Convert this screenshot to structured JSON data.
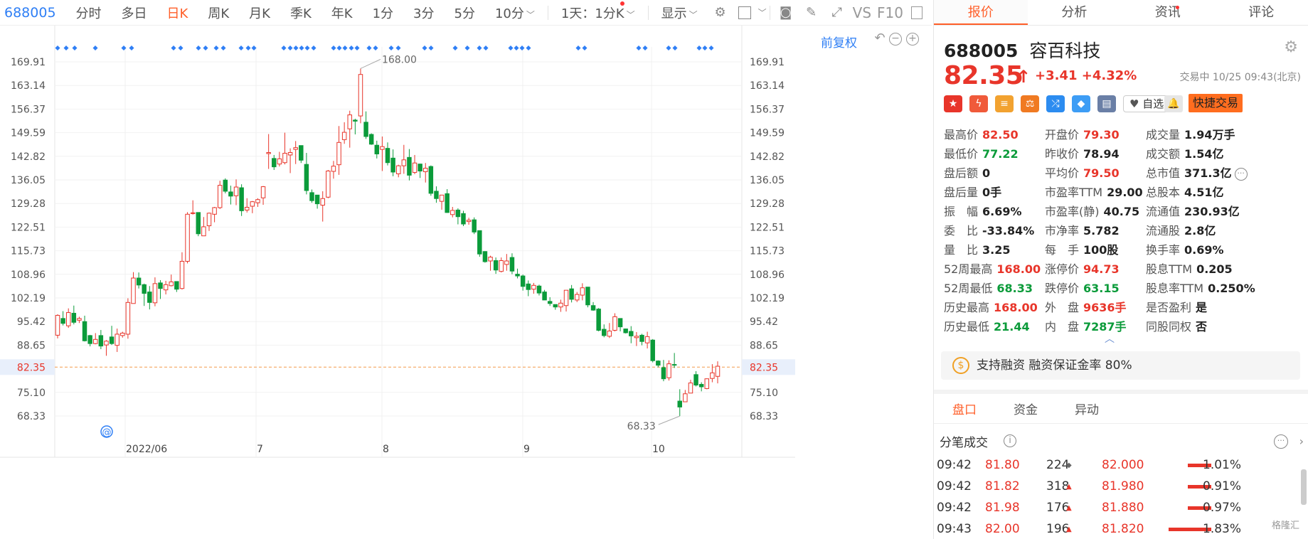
{
  "toolbar": {
    "code": "688005",
    "periods": [
      "分时",
      "多日",
      "日K",
      "周K",
      "月K",
      "季K",
      "年K",
      "1分",
      "3分",
      "5分",
      "10分"
    ],
    "active_period": "日K",
    "range": "1天：1分K",
    "display": "显示",
    "vs": "VS",
    "f10": "F10"
  },
  "chart": {
    "adjust_label": "前复权",
    "high_label": "168.00",
    "low_label": "68.33",
    "current_label": "82.35",
    "watermark_at": "@"
  },
  "chart_data": {
    "type": "candlestick",
    "yticks": [
      "169.91",
      "163.14",
      "156.37",
      "149.59",
      "142.82",
      "136.05",
      "129.28",
      "122.51",
      "115.73",
      "108.96",
      "102.19",
      "95.42",
      "88.65",
      "82.35",
      "75.10",
      "68.33"
    ],
    "xticks": [
      "2022/06",
      "7",
      "8",
      "9",
      "10"
    ],
    "ylim": [
      64.9,
      173.3
    ],
    "candles": [
      [
        91.5,
        97.2,
        90.6,
        97.5
      ],
      [
        96.3,
        94.9,
        94.3,
        98.4
      ],
      [
        94.2,
        98.0,
        93.6,
        99.2
      ],
      [
        97.8,
        95.2,
        94.6,
        100.0
      ],
      [
        95.8,
        96.3,
        95.0,
        96.8
      ],
      [
        95.4,
        89.9,
        89.7,
        97.1
      ],
      [
        91.4,
        89.1,
        88.3,
        91.6
      ],
      [
        89.1,
        90.3,
        88.9,
        92.1
      ],
      [
        91.4,
        88.4,
        87.5,
        93.0
      ],
      [
        88.7,
        89.8,
        85.6,
        90.1
      ],
      [
        91.0,
        89.1,
        88.7,
        94.2
      ],
      [
        88.6,
        91.8,
        86.7,
        93.4
      ],
      [
        91.4,
        92.1,
        90.8,
        92.5
      ],
      [
        91.8,
        100.9,
        90.5,
        102.1
      ],
      [
        100.6,
        107.9,
        100.6,
        109.6
      ],
      [
        107.9,
        105.9,
        104.9,
        109.5
      ],
      [
        106.0,
        103.5,
        99.9,
        106.3
      ],
      [
        103.9,
        100.9,
        98.9,
        105.6
      ],
      [
        100.8,
        106.3,
        99.8,
        108.1
      ],
      [
        106.5,
        104.9,
        101.9,
        107.3
      ],
      [
        104.5,
        106.0,
        103.2,
        107.1
      ],
      [
        105.7,
        106.8,
        105.5,
        108.9
      ],
      [
        106.9,
        104.7,
        103.9,
        105.7
      ],
      [
        104.9,
        112.7,
        104.6,
        115.3
      ],
      [
        112.7,
        126.2,
        112.1,
        126.8
      ],
      [
        126.5,
        126.6,
        126.1,
        130.2
      ],
      [
        126.7,
        120.6,
        119.9,
        126.7
      ],
      [
        120.0,
        122.6,
        121.0,
        125.4
      ],
      [
        122.9,
        126.5,
        121.4,
        126.7
      ],
      [
        126.2,
        128.1,
        123.9,
        128.3
      ],
      [
        128.1,
        134.5,
        127.7,
        135.8
      ],
      [
        136.0,
        132.8,
        132.2,
        136.5
      ],
      [
        132.6,
        131.4,
        129.0,
        134.4
      ],
      [
        131.5,
        134.0,
        128.8,
        136.2
      ],
      [
        133.8,
        127.2,
        125.7,
        134.8
      ],
      [
        127.4,
        128.2,
        126.7,
        130.8
      ],
      [
        128.5,
        129.8,
        126.5,
        130.0
      ],
      [
        129.5,
        130.4,
        128.3,
        130.8
      ],
      [
        130.9,
        134.1,
        128.9,
        134.3
      ],
      [
        143.6,
        143.9,
        139.2,
        149.2
      ],
      [
        142.2,
        139.8,
        138.9,
        143.2
      ],
      [
        140.6,
        142.1,
        139.9,
        144.1
      ],
      [
        141.0,
        143.7,
        140.5,
        149.6
      ],
      [
        143.2,
        143.9,
        138.0,
        145.1
      ],
      [
        144.8,
        145.3,
        140.6,
        147.2
      ],
      [
        145.9,
        141.7,
        140.9,
        145.9
      ],
      [
        140.5,
        133.0,
        131.9,
        143.8
      ],
      [
        132.4,
        130.1,
        129.5,
        133.3
      ],
      [
        131.7,
        129.2,
        127.8,
        131.5
      ],
      [
        128.8,
        130.7,
        124.1,
        132.8
      ],
      [
        131.1,
        138.6,
        130.8,
        138.9
      ],
      [
        138.5,
        140.0,
        136.4,
        141.5
      ],
      [
        140.4,
        146.8,
        137.5,
        151.5
      ],
      [
        147.6,
        149.7,
        146.4,
        152.6
      ],
      [
        150.7,
        154.7,
        145.3,
        155.9
      ],
      [
        153.2,
        152.9,
        149.1,
        153.6
      ],
      [
        154.4,
        166.3,
        152.3,
        168.0
      ],
      [
        152.6,
        148.5,
        147.8,
        155.7
      ],
      [
        149.1,
        146.3,
        146.1,
        149.4
      ],
      [
        146.0,
        143.5,
        142.2,
        147.3
      ],
      [
        144.8,
        145.6,
        138.6,
        148.5
      ],
      [
        145.1,
        141.0,
        140.2,
        146.8
      ],
      [
        142.3,
        138.3,
        137.1,
        144.8
      ],
      [
        137.8,
        140.1,
        136.8,
        140.4
      ],
      [
        140.1,
        141.8,
        137.8,
        146.1
      ],
      [
        142.5,
        137.4,
        135.9,
        144.9
      ],
      [
        138.2,
        140.9,
        137.7,
        143.2
      ],
      [
        140.6,
        138.6,
        136.6,
        140.7
      ],
      [
        138.4,
        139.4,
        135.3,
        140.9
      ],
      [
        139.9,
        132.2,
        131.5,
        140.2
      ],
      [
        132.8,
        130.7,
        129.5,
        134.2
      ],
      [
        129.9,
        131.7,
        127.5,
        131.7
      ],
      [
        132.1,
        126.7,
        126.6,
        133.4
      ],
      [
        126.1,
        127.3,
        125.3,
        128.3
      ],
      [
        127.4,
        125.5,
        123.3,
        127.9
      ],
      [
        126.4,
        123.4,
        122.8,
        127.2
      ],
      [
        124.1,
        124.5,
        123.2,
        125.2
      ],
      [
        124.6,
        121.1,
        120.5,
        125.3
      ],
      [
        121.5,
        114.8,
        114.0,
        121.5
      ],
      [
        115.5,
        112.6,
        112.3,
        115.6
      ],
      [
        112.8,
        113.9,
        110.0,
        114.3
      ],
      [
        112.9,
        110.2,
        109.1,
        113.8
      ],
      [
        109.8,
        112.9,
        109.5,
        113.8
      ],
      [
        111.8,
        112.8,
        110.0,
        114.8
      ],
      [
        113.8,
        109.9,
        109.0,
        115.0
      ],
      [
        109.0,
        108.5,
        107.8,
        110.6
      ],
      [
        108.5,
        105.5,
        104.3,
        108.9
      ],
      [
        106.2,
        104.6,
        102.7,
        107.2
      ],
      [
        104.7,
        105.8,
        103.4,
        106.5
      ],
      [
        105.6,
        103.6,
        102.9,
        106.0
      ],
      [
        103.9,
        101.6,
        101.7,
        104.5
      ],
      [
        101.2,
        100.6,
        99.9,
        102.4
      ],
      [
        100.3,
        99.6,
        98.8,
        100.2
      ],
      [
        99.6,
        100.7,
        98.2,
        101.7
      ],
      [
        100.0,
        104.4,
        98.3,
        104.2
      ],
      [
        104.8,
        101.8,
        100.9,
        105.9
      ],
      [
        101.6,
        103.2,
        101.0,
        103.9
      ],
      [
        103.0,
        105.1,
        101.5,
        106.4
      ],
      [
        105.3,
        100.2,
        99.5,
        105.2
      ],
      [
        100.0,
        98.7,
        98.5,
        101.0
      ],
      [
        99.0,
        92.9,
        92.6,
        99.3
      ],
      [
        93.2,
        91.4,
        90.9,
        94.6
      ],
      [
        91.2,
        92.7,
        90.7,
        95.0
      ],
      [
        92.9,
        96.8,
        92.6,
        97.8
      ],
      [
        96.3,
        93.9,
        92.6,
        96.3
      ],
      [
        93.3,
        92.2,
        92.0,
        93.4
      ],
      [
        92.6,
        91.3,
        89.2,
        94.1
      ],
      [
        90.8,
        91.2,
        88.4,
        92.4
      ],
      [
        91.5,
        89.7,
        88.6,
        91.9
      ],
      [
        89.3,
        91.1,
        87.7,
        92.5
      ],
      [
        90.1,
        84.2,
        83.7,
        90.4
      ],
      [
        84.1,
        82.9,
        82.3,
        84.3
      ],
      [
        82.2,
        79.0,
        78.3,
        84.4
      ],
      [
        79.3,
        83.3,
        78.5,
        84.3
      ],
      [
        83.1,
        83.0,
        82.1,
        86.4
      ],
      [
        72.6,
        70.9,
        68.3,
        76.0
      ],
      [
        72.4,
        74.7,
        72.5,
        75.8
      ],
      [
        74.9,
        77.8,
        74.9,
        78.7
      ],
      [
        80.2,
        77.2,
        76.8,
        81.2
      ],
      [
        77.4,
        76.7,
        75.4,
        78.0
      ],
      [
        76.2,
        79.0,
        76.0,
        79.1
      ],
      [
        79.1,
        80.7,
        78.0,
        83.2
      ],
      [
        79.7,
        82.6,
        77.7,
        84.0
      ]
    ]
  },
  "tabs": [
    "报价",
    "分析",
    "资讯",
    "评论"
  ],
  "quote": {
    "code": "688005",
    "name": "容百科技",
    "price": "82.35",
    "change": "+3.41",
    "change_pct": "+4.32%",
    "status": "交易中 10/25 09:43(北京)",
    "watch_label": "自选",
    "quick_trade": "快捷交易",
    "rows": [
      [
        [
          "最高价",
          "82.50",
          "red"
        ],
        [
          "开盘价",
          "79.30",
          "red"
        ],
        [
          "成交量",
          "1.94万手",
          ""
        ]
      ],
      [
        [
          "最低价",
          "77.22",
          "green"
        ],
        [
          "昨收价",
          "78.94",
          ""
        ],
        [
          "成交额",
          "1.54亿",
          ""
        ]
      ],
      [
        [
          "盘后额",
          "0",
          ""
        ],
        [
          "平均价",
          "79.50",
          "red"
        ],
        [
          "总市值",
          "371.3亿",
          ""
        ]
      ],
      [
        [
          "盘后量",
          "0手",
          ""
        ],
        [
          "市盈率TTM",
          "29.00",
          ""
        ],
        [
          "总股本",
          "4.51亿",
          ""
        ]
      ],
      [
        [
          "振　幅",
          "6.69%",
          ""
        ],
        [
          "市盈率(静)",
          "40.75",
          ""
        ],
        [
          "流通值",
          "230.93亿",
          ""
        ]
      ],
      [
        [
          "委　比",
          "-33.84%",
          ""
        ],
        [
          "市净率",
          "5.782",
          ""
        ],
        [
          "流通股",
          "2.8亿",
          ""
        ]
      ],
      [
        [
          "量　比",
          "3.25",
          ""
        ],
        [
          "每　手",
          "100股",
          ""
        ],
        [
          "换手率",
          "0.69%",
          ""
        ]
      ],
      [
        [
          "52周最高",
          "168.00",
          "red"
        ],
        [
          "涨停价",
          "94.73",
          "red"
        ],
        [
          "股息TTM",
          "0.205",
          ""
        ]
      ],
      [
        [
          "52周最低",
          "68.33",
          "green"
        ],
        [
          "跌停价",
          "63.15",
          "green"
        ],
        [
          "股息率TTM",
          "0.250%",
          ""
        ]
      ],
      [
        [
          "历史最高",
          "168.00",
          "red"
        ],
        [
          "外　盘",
          "9636手",
          "red"
        ],
        [
          "是否盈利",
          "是",
          ""
        ]
      ],
      [
        [
          "历史最低",
          "21.44",
          "green"
        ],
        [
          "内　盘",
          "7287手",
          "green"
        ],
        [
          "同股同权",
          "否",
          ""
        ]
      ]
    ],
    "margin_text": "支持融资 融资保证金率 80%",
    "margin_icon": "$"
  },
  "lower": {
    "subtabs": [
      "盘口",
      "资金",
      "异动"
    ],
    "ticks_title": "分笔成交",
    "ticks": [
      [
        "09:42",
        "81.80",
        "224",
        "◆",
        "82.000",
        0.55,
        "1.01%"
      ],
      [
        "09:42",
        "81.82",
        "318",
        "▲",
        "81.980",
        0.55,
        "0.91%"
      ],
      [
        "09:42",
        "81.98",
        "176",
        "▲",
        "81.880",
        0.55,
        "0.97%"
      ],
      [
        "09:43",
        "82.00",
        "196",
        "▲",
        "81.820",
        1.0,
        "1.83%"
      ]
    ],
    "watermark": "格隆汇"
  }
}
